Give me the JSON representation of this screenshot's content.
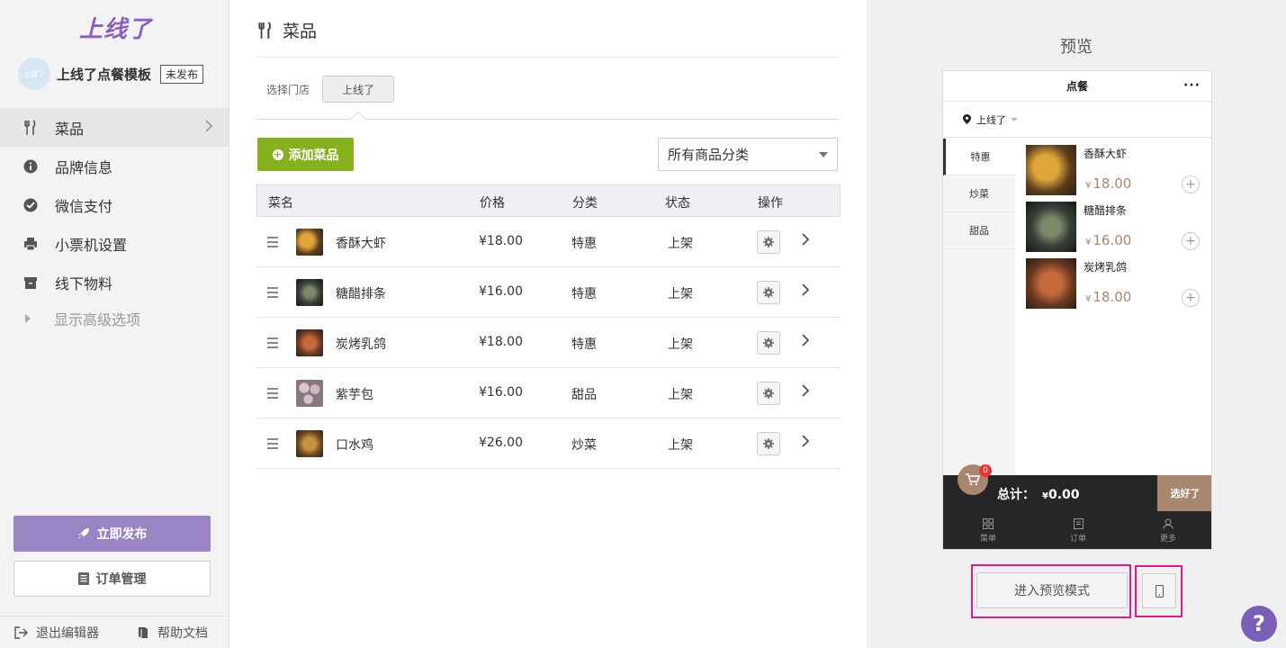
{
  "brand": {
    "logo_text": "上线了",
    "accent": "#8b5fc0"
  },
  "store": {
    "avatar_text": "上线了",
    "name": "上线了点餐模板",
    "status_badge": "未发布"
  },
  "sidebar": {
    "items": [
      {
        "label": "菜品",
        "icon": "fork-knife-icon",
        "active": true
      },
      {
        "label": "品牌信息",
        "icon": "info-icon"
      },
      {
        "label": "微信支付",
        "icon": "wechat-pay-icon"
      },
      {
        "label": "小票机设置",
        "icon": "printer-icon"
      },
      {
        "label": "线下物料",
        "icon": "box-icon"
      }
    ],
    "advanced_label": "显示高级选项",
    "publish_label": "立即发布",
    "orders_label": "订单管理",
    "exit_label": "退出编辑器",
    "help_label": "帮助文档"
  },
  "main": {
    "title": "菜品",
    "store_select_label": "选择门店",
    "store_option": "上线了",
    "add_label": "添加菜品",
    "category_filter": "所有商品分类",
    "columns": [
      "菜名",
      "价格",
      "分类",
      "状态",
      "操作"
    ],
    "rows": [
      {
        "name": "香酥大虾",
        "price": "¥18.00",
        "category": "特惠",
        "status": "上架"
      },
      {
        "name": "糖醋排条",
        "price": "¥16.00",
        "category": "特惠",
        "status": "上架"
      },
      {
        "name": "炭烤乳鸽",
        "price": "¥18.00",
        "category": "特惠",
        "status": "上架"
      },
      {
        "name": "紫芋包",
        "price": "¥16.00",
        "category": "甜品",
        "status": "上架"
      },
      {
        "name": "口水鸡",
        "price": "¥26.00",
        "category": "炒菜",
        "status": "上架"
      }
    ]
  },
  "preview": {
    "title": "预览",
    "phone": {
      "header": "点餐",
      "more": "···",
      "location": "上线了",
      "categories": [
        "特惠",
        "炒菜",
        "甜品"
      ],
      "items": [
        {
          "name": "香酥大虾",
          "currency": "¥",
          "price": "18.00"
        },
        {
          "name": "糖醋排条",
          "currency": "¥",
          "price": "16.00"
        },
        {
          "name": "炭烤乳鸽",
          "currency": "¥",
          "price": "18.00"
        }
      ],
      "cart_count": "0",
      "total_label": "总计：",
      "total_currency": "¥",
      "total_value": "0.00",
      "done_label": "选好了",
      "tabs": [
        "菜单",
        "订单",
        "更多"
      ]
    },
    "preview_mode_label": "进入预览模式",
    "help_glyph": "?"
  }
}
